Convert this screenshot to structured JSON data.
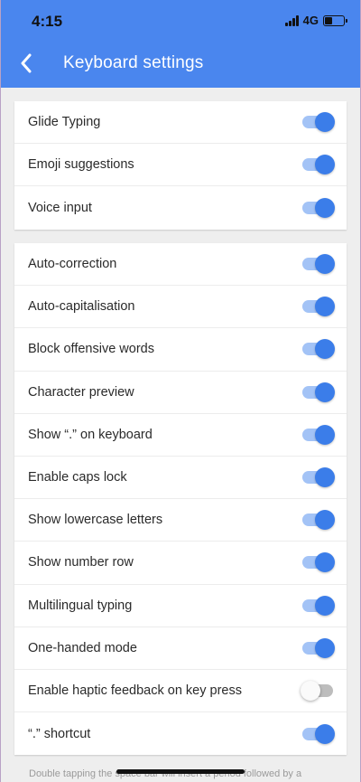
{
  "status_bar": {
    "time": "4:15",
    "network": "4G"
  },
  "nav": {
    "title": "Keyboard settings",
    "back_icon": "chevron-left-icon"
  },
  "colors": {
    "header_bg": "#4a86ee",
    "toggle_on": "#3b7de9",
    "toggle_on_track": "#a3c3f6",
    "toggle_off_track": "#bdbdbd"
  },
  "sections": [
    {
      "items": [
        {
          "label": "Glide Typing",
          "enabled": true
        },
        {
          "label": "Emoji suggestions",
          "enabled": true
        },
        {
          "label": "Voice input",
          "enabled": true
        }
      ]
    },
    {
      "items": [
        {
          "label": "Auto-correction",
          "enabled": true
        },
        {
          "label": "Auto-capitalisation",
          "enabled": true
        },
        {
          "label": "Block offensive words",
          "enabled": true
        },
        {
          "label": "Character preview",
          "enabled": true
        },
        {
          "label": "Show “.” on keyboard",
          "enabled": true
        },
        {
          "label": "Enable caps lock",
          "enabled": true
        },
        {
          "label": "Show lowercase letters",
          "enabled": true
        },
        {
          "label": "Show number row",
          "enabled": true
        },
        {
          "label": "Multilingual typing",
          "enabled": true
        },
        {
          "label": "One-handed mode",
          "enabled": true
        },
        {
          "label": "Enable haptic feedback on key press",
          "enabled": false
        },
        {
          "label": "“.” shortcut",
          "enabled": true
        }
      ]
    }
  ],
  "footnote": "Double tapping the space bar will insert a period followed by a"
}
